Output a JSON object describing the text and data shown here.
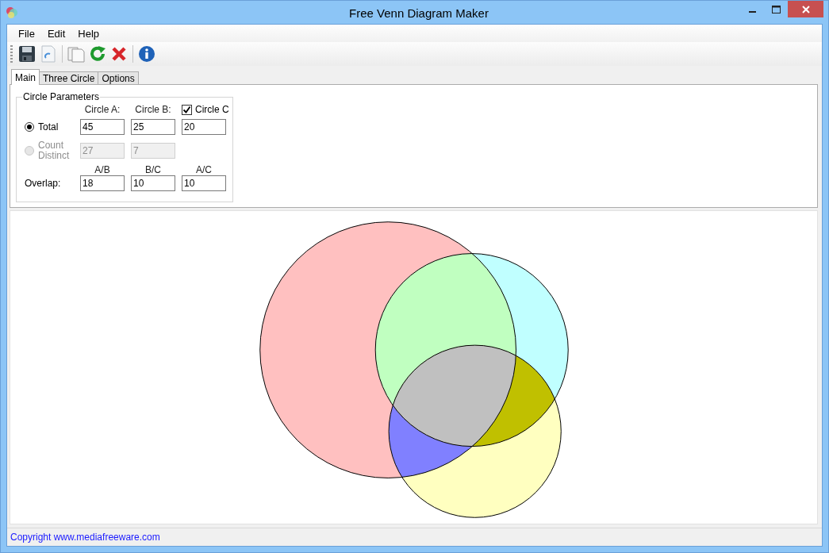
{
  "window": {
    "title": "Free Venn Diagram Maker"
  },
  "menu": [
    "File",
    "Edit",
    "Help"
  ],
  "tabs": [
    {
      "label": "Main",
      "selected": true
    },
    {
      "label": "Three Circle",
      "selected": false
    },
    {
      "label": "Options",
      "selected": false
    }
  ],
  "circle_parameters": {
    "title": "Circle Parameters",
    "column_headers": [
      "Circle A:",
      "Circle B:"
    ],
    "circle_c": {
      "label": "Circle C",
      "checked": true
    },
    "modes": [
      {
        "label": "Total",
        "selected": true,
        "disabled": false,
        "values": [
          "45",
          "25",
          "20"
        ]
      },
      {
        "label": "Count Distinct",
        "selected": false,
        "disabled": true,
        "values": [
          "27",
          "7"
        ]
      }
    ],
    "overlap": {
      "label": "Overlap:",
      "headers": [
        "A/B",
        "B/C",
        "A/C"
      ],
      "values": [
        "18",
        "10",
        "10"
      ]
    }
  },
  "status_bar": {
    "text": "Copyright www.mediafreeware.com"
  }
}
